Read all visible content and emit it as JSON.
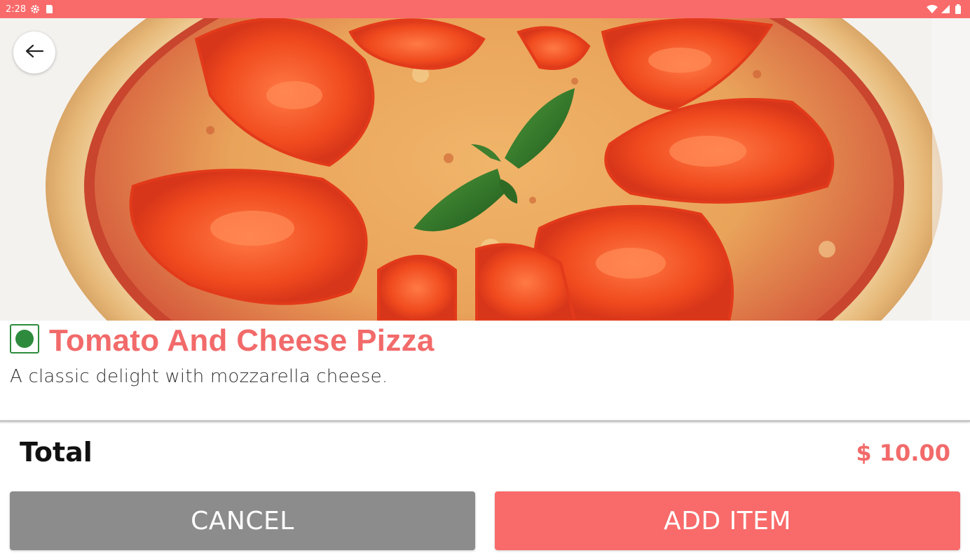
{
  "status_bar": {
    "time": "2:28",
    "icons": [
      "gear-icon",
      "sd-card-icon",
      "wifi-icon",
      "signal-icon",
      "battery-icon"
    ]
  },
  "hero": {
    "image_subject": "pizza-image",
    "back_icon": "arrow-left-icon"
  },
  "item": {
    "veg_indicator": "veg-icon",
    "name": "Tomato And Cheese Pizza",
    "description": "A classic delight with mozzarella cheese."
  },
  "total": {
    "label": "Total",
    "value": "$ 10.00"
  },
  "actions": {
    "cancel_label": "CANCEL",
    "add_label": "ADD ITEM"
  },
  "colors": {
    "accent": "#f96a6a",
    "title": "#f26a6a",
    "cancel": "#8c8c8c",
    "veg": "#2e8b3d"
  }
}
